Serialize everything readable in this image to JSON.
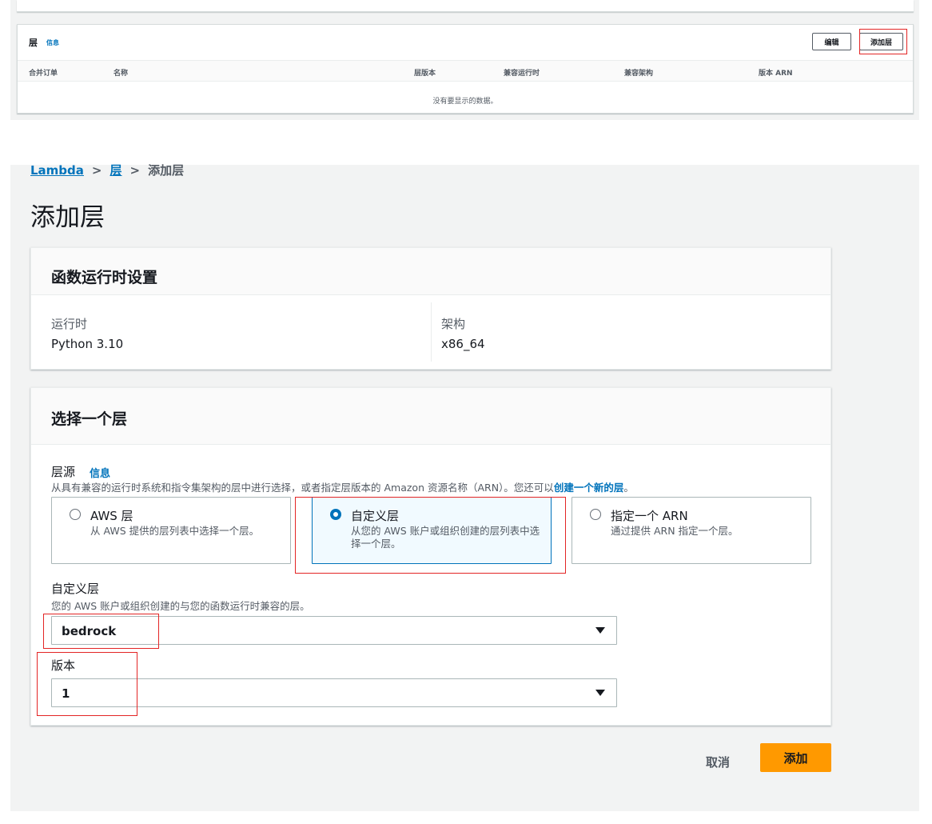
{
  "top": {
    "section_title": "层",
    "info_link": "信息",
    "edit_button": "编辑",
    "add_layer_button": "添加层",
    "columns": [
      "合并订单",
      "名称",
      "层版本",
      "兼容运行时",
      "兼容架构",
      "版本 ARN"
    ],
    "empty_message": "没有要显示的数据。"
  },
  "breadcrumb": {
    "items": [
      "Lambda",
      "层",
      "添加层"
    ]
  },
  "page_title": "添加层",
  "runtime_settings": {
    "title": "函数运行时设置",
    "runtime_label": "运行时",
    "runtime_value": "Python 3.10",
    "arch_label": "架构",
    "arch_value": "x86_64"
  },
  "choose_layer": {
    "title": "选择一个层",
    "source_label": "层源",
    "source_info": "信息",
    "source_desc": "从具有兼容的运行时系统和指令集架构的层中进行选择，或者指定层版本的 Amazon 资源名称（ARN）。您还可以",
    "source_desc_link": "创建一个新的层",
    "source_desc_end": "。",
    "options": [
      {
        "title": "AWS 层",
        "desc": "从 AWS 提供的层列表中选择一个层。",
        "selected": false
      },
      {
        "title": "自定义层",
        "desc": "从您的 AWS 账户或组织创建的层列表中选择一个层。",
        "selected": true
      },
      {
        "title": "指定一个 ARN",
        "desc": "通过提供 ARN 指定一个层。",
        "selected": false
      }
    ],
    "custom_label": "自定义层",
    "custom_desc": "您的 AWS 账户或组织创建的与您的函数运行时兼容的层。",
    "custom_value": "bedrock",
    "version_label": "版本",
    "version_value": "1"
  },
  "actions": {
    "cancel": "取消",
    "add": "添加"
  },
  "colors": {
    "accent": "#0073bb",
    "primary_button": "#ff9900",
    "annotation_box": "#e32525"
  }
}
